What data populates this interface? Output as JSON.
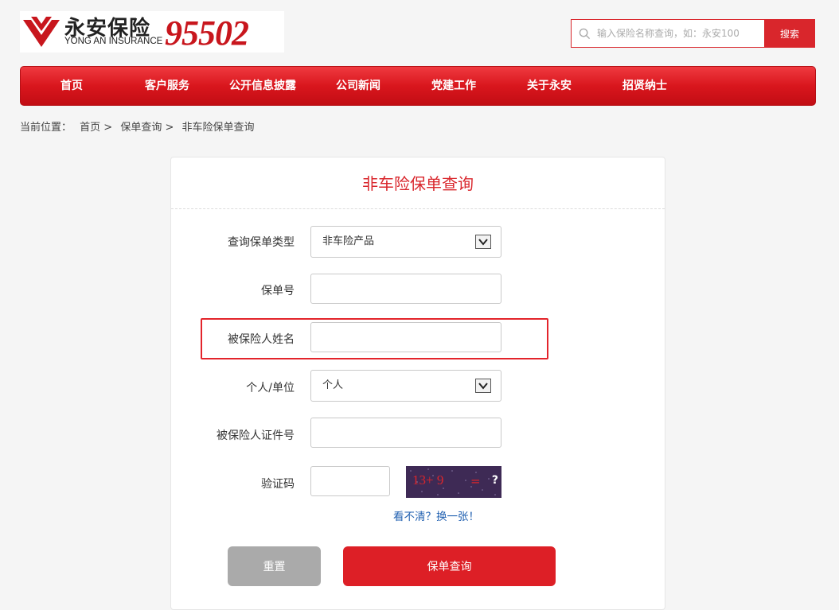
{
  "header": {
    "logo_cn": "永安保险",
    "logo_en": "YONG AN INSURANCE",
    "hotline": "95502"
  },
  "search": {
    "placeholder": "输入保险名称查询，如：永安100",
    "button": "搜索"
  },
  "nav": {
    "items": [
      "首页",
      "客户服务",
      "公开信息披露",
      "公司新闻",
      "党建工作",
      "关于永安",
      "招贤纳士"
    ]
  },
  "breadcrumb": {
    "prefix": "当前位置：",
    "items": [
      "首页 >",
      "保单查询 >",
      "非车险保单查询"
    ]
  },
  "form": {
    "title": "非车险保单查询",
    "policy_type": {
      "label": "查询保单类型",
      "value": "非车险产品"
    },
    "policy_no": {
      "label": "保单号",
      "value": ""
    },
    "insured_name": {
      "label": "被保险人姓名",
      "value": ""
    },
    "entity_type": {
      "label": "个人/单位",
      "value": "个人"
    },
    "insured_id": {
      "label": "被保险人证件号",
      "value": ""
    },
    "captcha": {
      "label": "验证码",
      "value": "",
      "image_text": "13+ 9",
      "image_eq": "=",
      "image_q": "?",
      "refresh_link": "看不清？换一张！"
    },
    "reset_button": "重置",
    "query_button": "保单查询"
  },
  "colors": {
    "brand_red": "#d9262c",
    "link_blue": "#1f5fb0",
    "reset_gray": "#aaaaaa"
  }
}
